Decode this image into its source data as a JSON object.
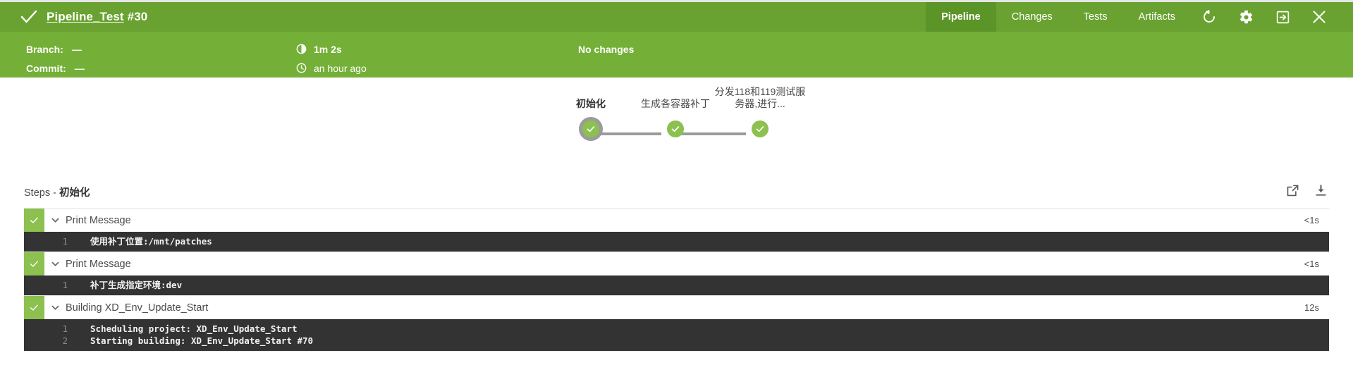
{
  "header": {
    "status_icon": "check-icon",
    "pipeline_name": "Pipeline_Test",
    "run_id": "#30",
    "tabs": [
      {
        "label": "Pipeline",
        "active": true
      },
      {
        "label": "Changes",
        "active": false
      },
      {
        "label": "Tests",
        "active": false
      },
      {
        "label": "Artifacts",
        "active": false
      }
    ],
    "actions": [
      {
        "name": "rerun-icon",
        "title": "Rerun"
      },
      {
        "name": "gear-icon",
        "title": "Settings"
      },
      {
        "name": "logout-icon",
        "title": "Go to classic"
      },
      {
        "name": "close-icon",
        "title": "Close"
      }
    ]
  },
  "subheader": {
    "branch_label": "Branch:",
    "branch_value": "—",
    "commit_label": "Commit:",
    "commit_value": "—",
    "duration_icon": "stopwatch-icon",
    "duration": "1m 2s",
    "time_icon": "clock-icon",
    "time_ago": "an hour ago",
    "changes": "No changes"
  },
  "graph": {
    "stages": [
      {
        "label": "初始化",
        "status": "success",
        "selected": true
      },
      {
        "label": "生成各容器补丁",
        "status": "success",
        "selected": false
      },
      {
        "label": "分发118和119测试服务器,进行...",
        "status": "success",
        "selected": false
      }
    ]
  },
  "steps_panel": {
    "title_prefix": "Steps - ",
    "stage_name": "初始化",
    "actions": [
      {
        "name": "open-external-icon",
        "title": "Open log in new window"
      },
      {
        "name": "download-icon",
        "title": "Download log"
      }
    ],
    "steps": [
      {
        "status": "success",
        "name": "Print Message",
        "duration": "<1s",
        "expanded": true,
        "log": [
          {
            "num": "1",
            "text": "使用补丁位置:/mnt/patches"
          }
        ]
      },
      {
        "status": "success",
        "name": "Print Message",
        "duration": "<1s",
        "expanded": true,
        "log": [
          {
            "num": "1",
            "text": "补丁生成指定环境:dev"
          }
        ]
      },
      {
        "status": "success",
        "name": "Building XD_Env_Update_Start",
        "duration": "12s",
        "expanded": true,
        "log": [
          {
            "num": "1",
            "text": "Scheduling project: XD_Env_Update_Start"
          },
          {
            "num": "2",
            "text": "Starting building: XD_Env_Update_Start #70"
          }
        ]
      }
    ]
  },
  "colors": {
    "header_green": "#69a230",
    "active_tab_green": "#5b9427",
    "subheader_green": "#74b037",
    "node_green": "#8cc04f",
    "line_gray": "#9b9b9b",
    "log_bg": "#333333"
  }
}
